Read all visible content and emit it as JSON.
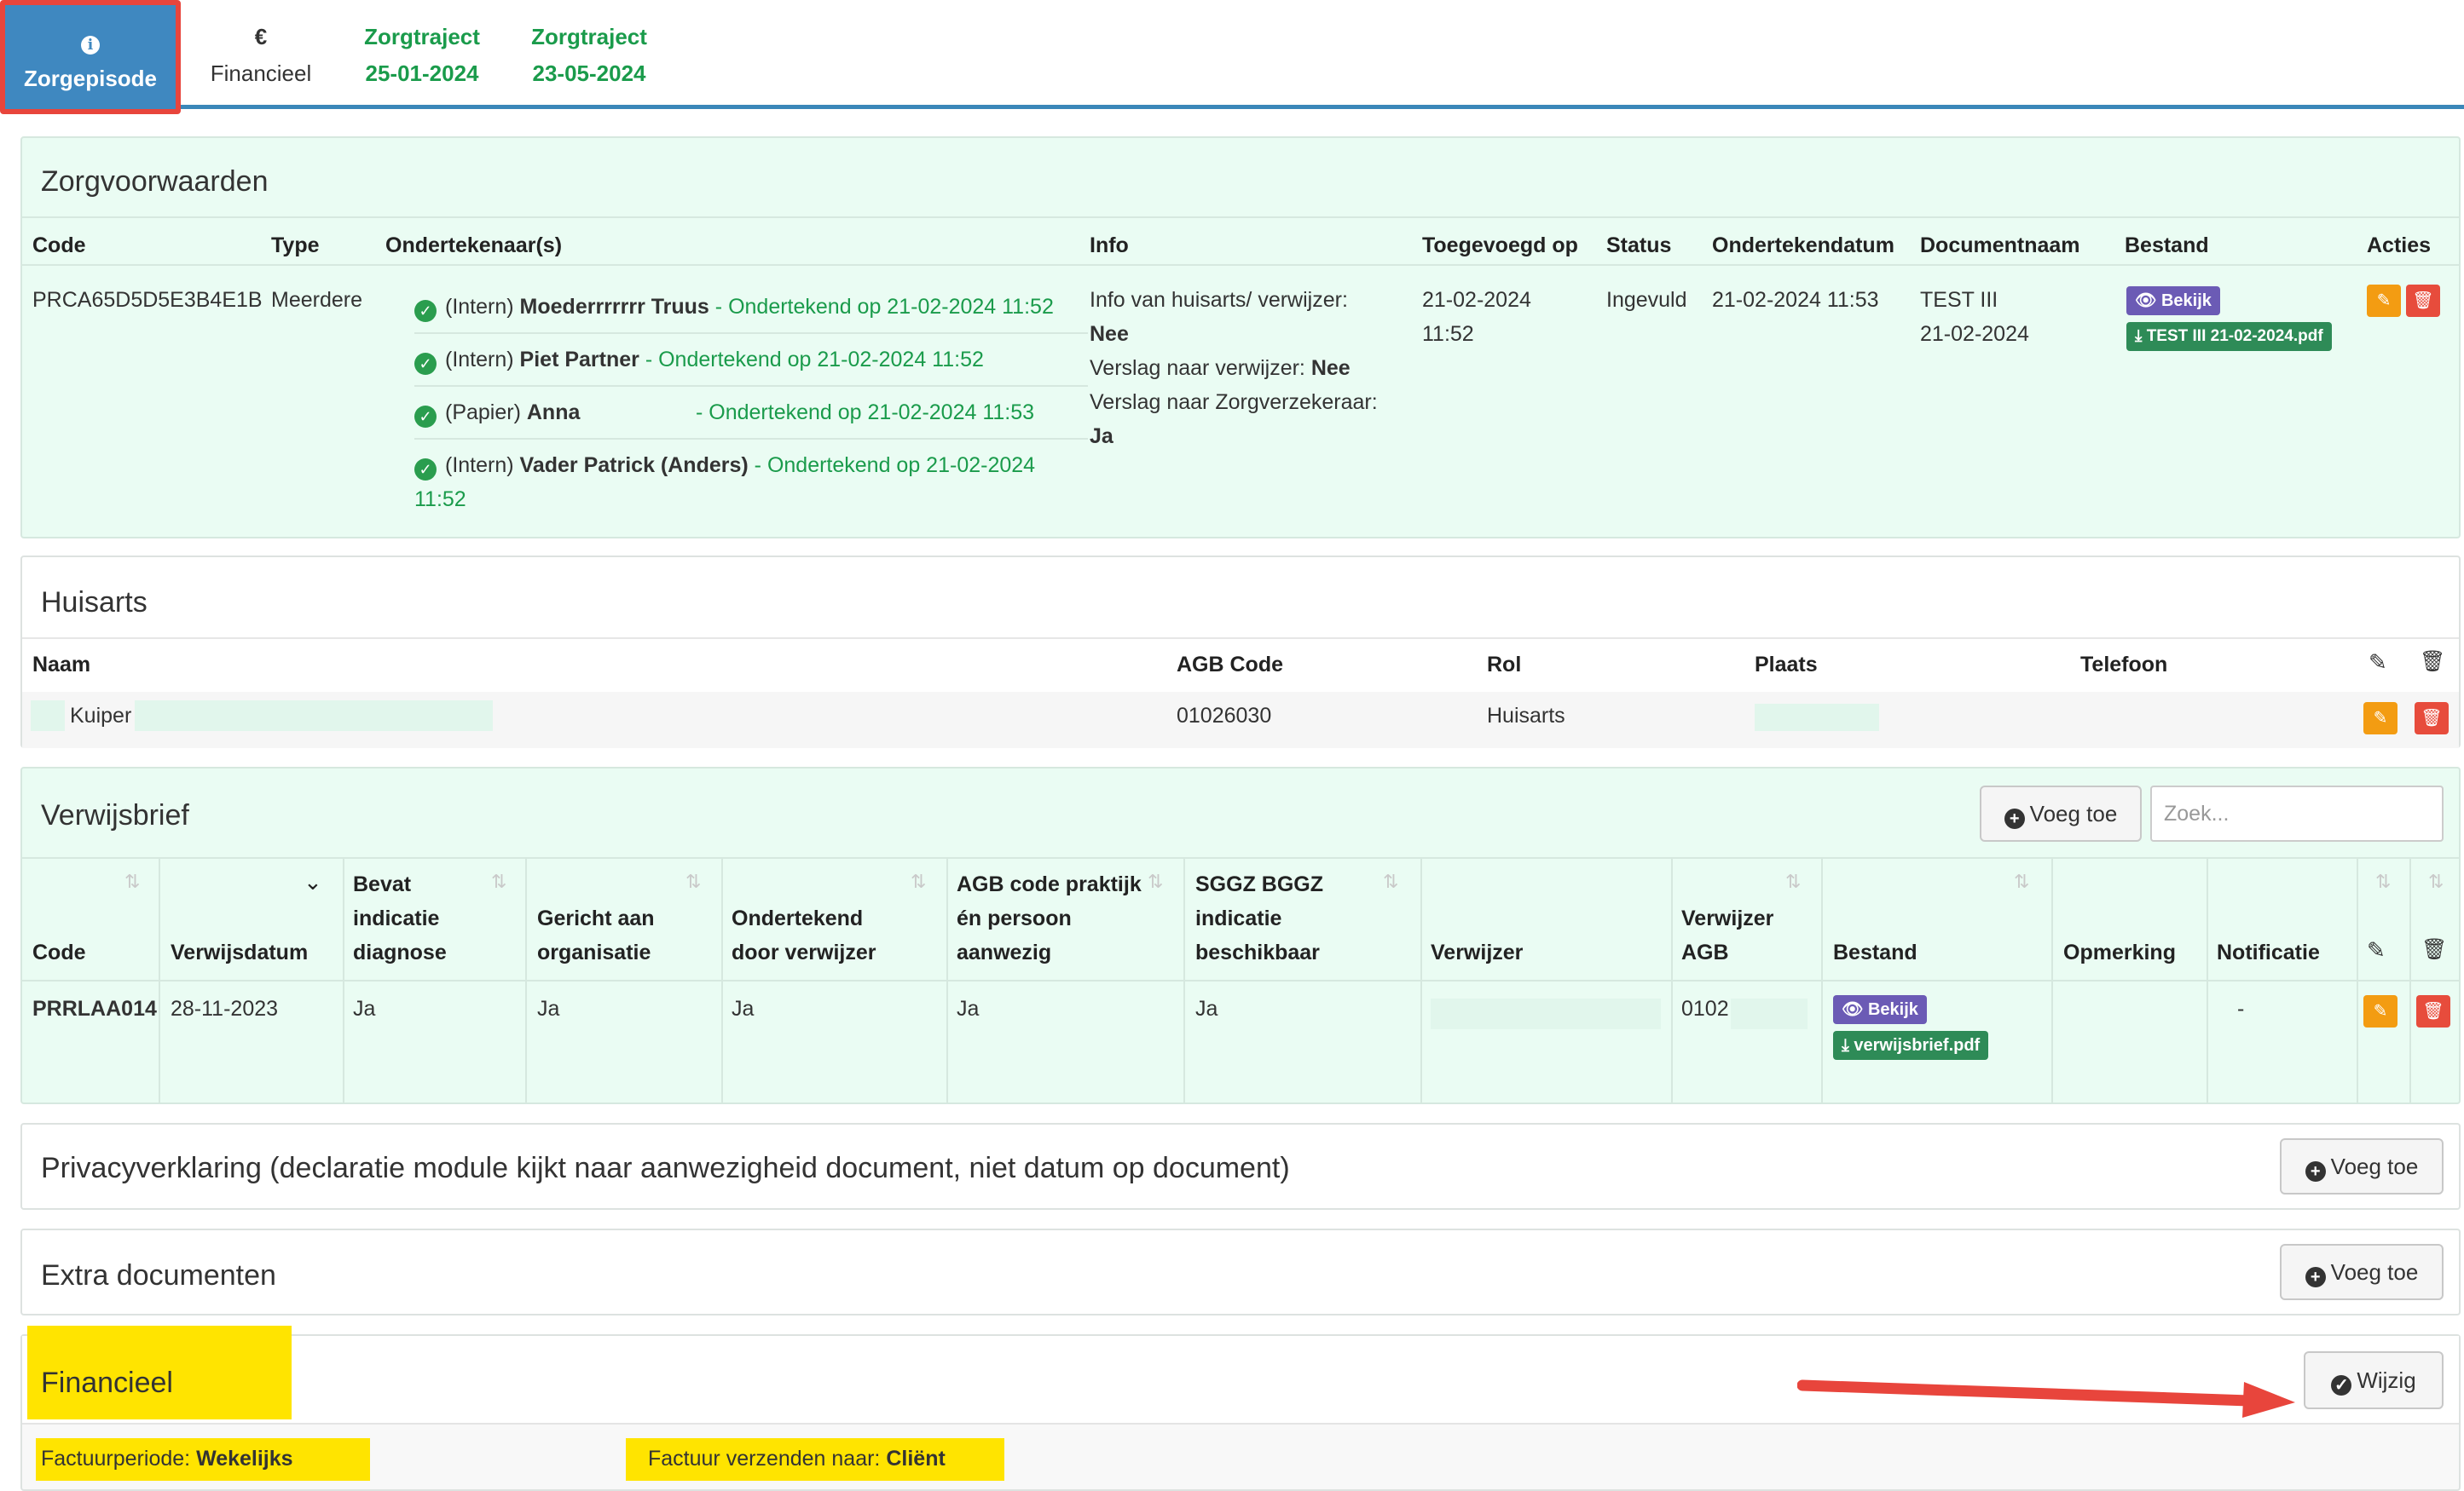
{
  "tabs": [
    {
      "label": "Zorgepisode",
      "icon": "info-icon",
      "active": true
    },
    {
      "label": "Financieel",
      "symbol": "€"
    },
    {
      "label": "Zorgtraject",
      "date": "25-01-2024"
    },
    {
      "label": "Zorgtraject",
      "date": "23-05-2024"
    }
  ],
  "zorgvoorwaarden": {
    "title": "Zorgvoorwaarden",
    "headers": [
      "Code",
      "Type",
      "Ondertekenaar(s)",
      "Info",
      "Toegevoegd op",
      "Status",
      "Ondertekendatum",
      "Documentnaam",
      "Bestand",
      "Acties"
    ],
    "row": {
      "code": "PRCA65D5D5E3B4E1B",
      "type": "Meerdere",
      "signers": [
        {
          "prefix": "(Intern)",
          "name": "Moederrrrrrr Truus",
          "signed": "- Ondertekend op 21-02-2024 11:52"
        },
        {
          "prefix": "(Intern)",
          "name": "Piet Partner",
          "signed": "- Ondertekend op 21-02-2024 11:52"
        },
        {
          "prefix": "(Papier)",
          "name": "Anna",
          "signed": "- Ondertekend op 21-02-2024 11:53"
        },
        {
          "prefix": "(Intern)",
          "name": "Vader Patrick (Anders)",
          "signed": "- Ondertekend op 21-02-2024",
          "signed_cont": "11:52"
        }
      ],
      "info": [
        {
          "label": "Info van huisarts/ verwijzer:",
          "value": "Nee"
        },
        {
          "label": "Verslag naar verwijzer:",
          "value": "Nee"
        },
        {
          "label": "Verslag naar Zorgverzekeraar:",
          "value": "Ja"
        }
      ],
      "added_date": "21-02-2024",
      "added_time": "11:52",
      "status": "Ingevuld",
      "signed_date": "21-02-2024 11:53",
      "docname": "TEST III",
      "docdate": "21-02-2024",
      "view_label": "Bekijk",
      "file_label": "TEST III 21-02-2024.pdf"
    }
  },
  "huisarts": {
    "title": "Huisarts",
    "headers": [
      "Naam",
      "AGB Code",
      "Rol",
      "Plaats",
      "Telefoon"
    ],
    "row": {
      "naam": "Kuiper",
      "agb": "01026030",
      "rol": "Huisarts"
    }
  },
  "verwijsbrief": {
    "title": "Verwijsbrief",
    "add_label": "Voeg toe",
    "search_placeholder": "Zoek...",
    "headers": {
      "code": "Code",
      "verwijsdatum": "Verwijsdatum",
      "bevat": [
        "Bevat",
        "indicatie",
        "diagnose"
      ],
      "gericht": [
        "Gericht aan",
        "organisatie"
      ],
      "ondertekend": [
        "Ondertekend",
        "door verwijzer"
      ],
      "agb_praktijk": [
        "AGB code praktijk",
        "én persoon",
        "aanwezig"
      ],
      "sggz": [
        "SGGZ BGGZ",
        "indicatie",
        "beschikbaar"
      ],
      "verwijzer": "Verwijzer",
      "verwijzer_agb": [
        "Verwijzer",
        "AGB"
      ],
      "bestand": "Bestand",
      "opmerking": "Opmerking",
      "notificatie": "Notificatie"
    },
    "row": {
      "code": "PRRLAA014",
      "datum": "28-11-2023",
      "bevat": "Ja",
      "gericht": "Ja",
      "ondertekend": "Ja",
      "agb_praktijk": "Ja",
      "sggz": "Ja",
      "verwijzer_agb": "0102",
      "view_label": "Bekijk",
      "file_label": "verwijsbrief.pdf",
      "notificatie": "-"
    }
  },
  "privacy": {
    "title": "Privacyverklaring (declaratie module kijkt naar aanwezigheid document, niet datum op document)",
    "add_label": "Voeg toe"
  },
  "extra": {
    "title": "Extra documenten",
    "add_label": "Voeg toe"
  },
  "financieel": {
    "title": "Financieel",
    "edit_label": "Wijzig",
    "periode_label": "Factuurperiode:",
    "periode_value": "Wekelijks",
    "verzenden_label": "Factuur verzenden naar:",
    "verzenden_value": "Cliënt"
  },
  "colors": {
    "tab_active": "#3f88c0",
    "highlight_border": "#e8453c",
    "mint_panel": "#eafcf3",
    "green_text": "#1a9b4b",
    "edit_button": "#f39c12",
    "delete_button": "#e74c3c",
    "view_badge": "#6b5bb5",
    "file_badge": "#2e8b57",
    "annotation_yellow": "#ffe400"
  }
}
